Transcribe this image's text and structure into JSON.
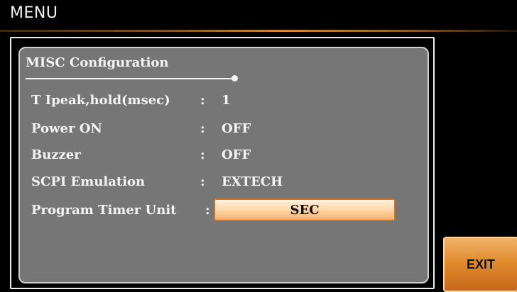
{
  "menu": {
    "title": "MENU"
  },
  "panel": {
    "title": "MISC Configuration",
    "rows": [
      {
        "label": "T Ipeak,hold(msec)",
        "colon": ":",
        "value": "1"
      },
      {
        "label": "Power ON",
        "colon": ":",
        "value": "OFF"
      },
      {
        "label": "Buzzer",
        "colon": ":",
        "value": "OFF"
      },
      {
        "label": "SCPI Emulation",
        "colon": ":",
        "value": "EXTECH"
      },
      {
        "label": "Program Timer Unit",
        "colon": ":",
        "value": "SEC"
      }
    ]
  },
  "softkeys": {
    "exit_label": "EXIT"
  },
  "colors": {
    "background": "#000000",
    "panel": "#767676",
    "accent_orange": "#e08c2c",
    "selected_field": "#ffd8a8",
    "text": "#f4f4f4"
  }
}
